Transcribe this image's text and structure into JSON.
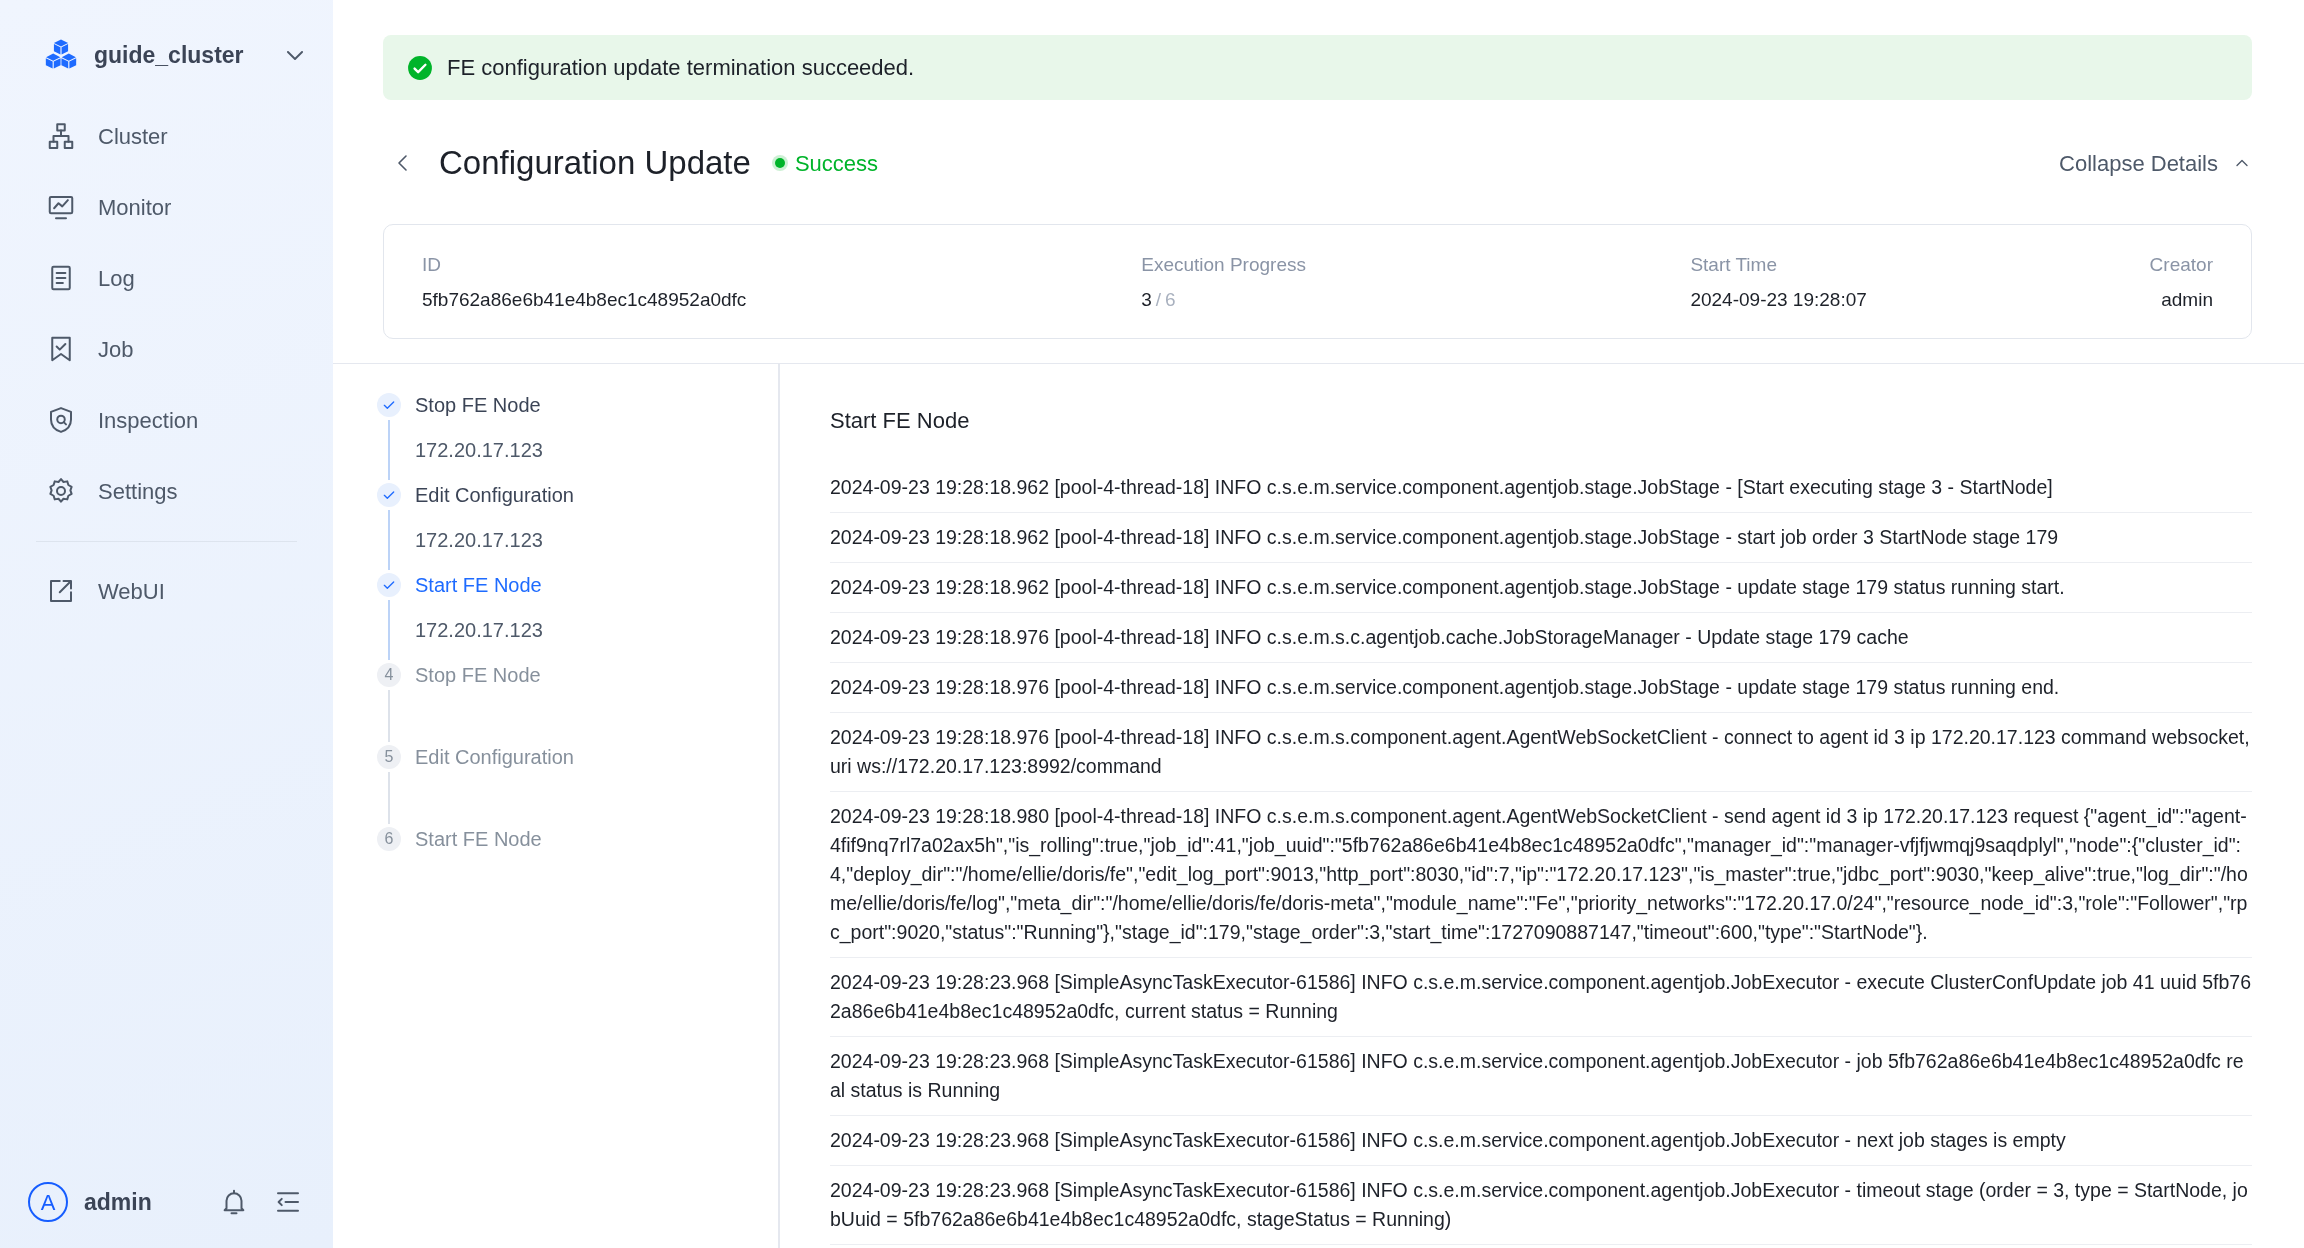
{
  "sidebar": {
    "cluster_name": "guide_cluster",
    "items": [
      {
        "label": "Cluster"
      },
      {
        "label": "Monitor"
      },
      {
        "label": "Log"
      },
      {
        "label": "Job"
      },
      {
        "label": "Inspection"
      },
      {
        "label": "Settings"
      }
    ],
    "links": [
      {
        "label": "WebUI"
      }
    ],
    "user": {
      "avatar_letter": "A",
      "name": "admin"
    }
  },
  "alert": {
    "kind": "success",
    "message": "FE configuration update termination succeeded."
  },
  "header": {
    "title": "Configuration Update",
    "status": {
      "kind": "success",
      "label": "Success"
    },
    "toggle": {
      "label": "Collapse Details",
      "expanded": true
    }
  },
  "details": {
    "id_label": "ID",
    "id": "5fb762a86e6b41e4b8ec1c48952a0dfc",
    "progress_label": "Execution Progress",
    "progress_done": "3",
    "progress_separator": "/",
    "progress_total": "6",
    "start_label": "Start Time",
    "start_time": "2024-09-23 19:28:07",
    "creator_label": "Creator",
    "creator": "admin"
  },
  "steps": [
    {
      "title": "Stop FE Node",
      "kind": "done",
      "selected": false,
      "hosts": [
        "172.20.17.123"
      ]
    },
    {
      "title": "Edit Configuration",
      "kind": "done",
      "selected": false,
      "hosts": [
        "172.20.17.123"
      ]
    },
    {
      "title": "Start FE Node",
      "kind": "done",
      "selected": true,
      "hosts": [
        "172.20.17.123"
      ]
    },
    {
      "title": "Stop FE Node",
      "kind": "pending",
      "selected": false,
      "number": "4"
    },
    {
      "title": "Edit Configuration",
      "kind": "pending",
      "selected": false,
      "number": "5"
    },
    {
      "title": "Start FE Node",
      "kind": "pending",
      "selected": false,
      "number": "6"
    }
  ],
  "log": {
    "title": "Start FE Node",
    "lines": [
      "2024-09-23 19:28:18.962 [pool-4-thread-18] INFO c.s.e.m.service.component.agentjob.stage.JobStage - [Start executing stage 3 - StartNode]",
      "2024-09-23 19:28:18.962 [pool-4-thread-18] INFO  c.s.e.m.service.component.agentjob.stage.JobStage - start job order 3 StartNode stage 179",
      "2024-09-23 19:28:18.962 [pool-4-thread-18] INFO  c.s.e.m.service.component.agentjob.stage.JobStage - update stage 179 status running start.",
      "2024-09-23 19:28:18.976 [pool-4-thread-18] INFO  c.s.e.m.s.c.agentjob.cache.JobStorageManager - Update stage 179 cache",
      "2024-09-23 19:28:18.976 [pool-4-thread-18] INFO  c.s.e.m.service.component.agentjob.stage.JobStage - update stage 179 status running end.",
      "2024-09-23 19:28:18.976 [pool-4-thread-18] INFO  c.s.e.m.s.component.agent.AgentWebSocketClient - connect to agent id 3 ip 172.20.17.123 command websocket, uri ws://172.20.17.123:8992/command",
      "2024-09-23 19:28:18.980 [pool-4-thread-18] INFO  c.s.e.m.s.component.agent.AgentWebSocketClient - send agent id 3 ip 172.20.17.123 request {\"agent_id\":\"agent-4fif9nq7rl7a02ax5h\",\"is_rolling\":true,\"job_id\":41,\"job_uuid\":\"5fb762a86e6b41e4b8ec1c48952a0dfc\",\"manager_id\":\"manager-vfjfjwmqj9saqdplyl\",\"node\":{\"cluster_id\":4,\"deploy_dir\":\"/home/ellie/doris/fe\",\"edit_log_port\":9013,\"http_port\":8030,\"id\":7,\"ip\":\"172.20.17.123\",\"is_master\":true,\"jdbc_port\":9030,\"keep_alive\":true,\"log_dir\":\"/home/ellie/doris/fe/log\",\"meta_dir\":\"/home/ellie/doris/fe/doris-meta\",\"module_name\":\"Fe\",\"priority_networks\":\"172.20.17.0/24\",\"resource_node_id\":3,\"role\":\"Follower\",\"rpc_port\":9020,\"status\":\"Running\"},\"stage_id\":179,\"stage_order\":3,\"start_time\":1727090887147,\"timeout\":600,\"type\":\"StartNode\"}.",
      "2024-09-23 19:28:23.968 [SimpleAsyncTaskExecutor-61586] INFO  c.s.e.m.service.component.agentjob.JobExecutor - execute ClusterConfUpdate job 41 uuid 5fb762a86e6b41e4b8ec1c48952a0dfc, current status = Running",
      "2024-09-23 19:28:23.968 [SimpleAsyncTaskExecutor-61586] INFO  c.s.e.m.service.component.agentjob.JobExecutor - job 5fb762a86e6b41e4b8ec1c48952a0dfc real status is Running",
      "2024-09-23 19:28:23.968 [SimpleAsyncTaskExecutor-61586] INFO  c.s.e.m.service.component.agentjob.JobExecutor - next job stages is empty",
      "2024-09-23 19:28:23.968 [SimpleAsyncTaskExecutor-61586] INFO  c.s.e.m.service.component.agentjob.JobExecutor - timeout stage (order = 3, type = StartNode, jobUuid = 5fb762a86e6b41e4b8ec1c48952a0dfc, stageStatus = Running)"
    ]
  }
}
